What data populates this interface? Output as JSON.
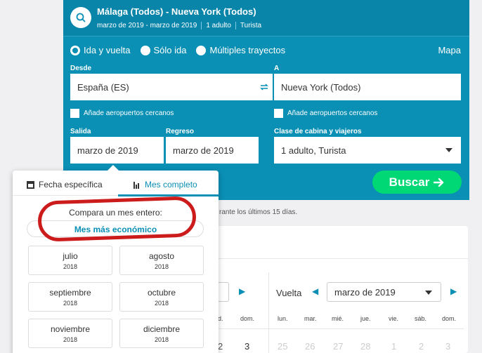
{
  "summary": {
    "route": "Málaga (Todos) - Nueva York (Todos)",
    "dates": "marzo de 2019 - marzo de 2019",
    "travellers": "1 adulto",
    "cabin": "Turista"
  },
  "trip_type": {
    "options": [
      "Ida y vuelta",
      "Sólo ida",
      "Múltiples trayectos"
    ],
    "selected": "Ida y vuelta"
  },
  "map_link": "Mapa",
  "from": {
    "label": "Desde",
    "value": "España (ES)",
    "nearby": "Añade aeropuertos cercanos"
  },
  "to": {
    "label": "A",
    "value": "Nueva York (Todos)",
    "nearby": "Añade aeropuertos cercanos"
  },
  "depart": {
    "label": "Salida",
    "value": "marzo de 2019"
  },
  "return": {
    "label": "Regreso",
    "value": "marzo de 2019"
  },
  "cabin_travellers": {
    "label": "Clase de cabina y viajeros",
    "value": "1 adulto, Turista"
  },
  "search_button": "Buscar",
  "background": {
    "note": "rante los últimos 15 días.",
    "vuelta_label": "Vuelta",
    "month_select": "marzo de 2019",
    "left_days": [
      "d.",
      "dom."
    ],
    "right_days": [
      "lun.",
      "mar.",
      "mié.",
      "jue.",
      "vie.",
      "sáb.",
      "dom."
    ],
    "left_numbers": [
      "2",
      "3"
    ],
    "right_numbers": [
      "25",
      "26",
      "27",
      "28",
      "1",
      "2",
      "3"
    ]
  },
  "popup": {
    "tab_specific": "Fecha específica",
    "tab_whole_month": "Mes completo",
    "active_tab": "Mes completo",
    "compare_text": "Compara un mes entero:",
    "cheapest_link": "Mes más económico",
    "months": [
      {
        "name": "julio",
        "year": "2018"
      },
      {
        "name": "agosto",
        "year": "2018"
      },
      {
        "name": "septiembre",
        "year": "2018"
      },
      {
        "name": "octubre",
        "year": "2018"
      },
      {
        "name": "noviembre",
        "year": "2018"
      },
      {
        "name": "diciembre",
        "year": "2018"
      }
    ]
  },
  "colors": {
    "panel": "#0a8fb5",
    "accent": "#0a8fb5",
    "search_button": "#00d775",
    "annotation_ring": "#cc1b1b"
  },
  "icons": [
    "search-icon",
    "swap-icon",
    "calendar-icon",
    "bar-chart-icon",
    "arrow-right-icon",
    "chevron-down-icon",
    "caret-left-icon",
    "caret-right-icon"
  ]
}
